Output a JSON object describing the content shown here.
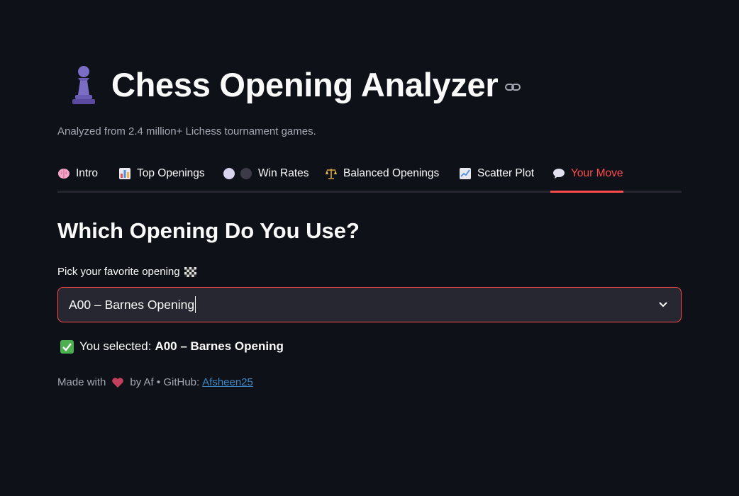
{
  "header": {
    "title": "Chess Opening Analyzer",
    "subtitle": "Analyzed from 2.4 million+ Lichess tournament games.",
    "icon": "pawn-icon",
    "anchor_icon": "link-icon"
  },
  "tabs": [
    {
      "label": "Intro",
      "icon": "brain-icon"
    },
    {
      "label": "Top Openings",
      "icon": "bar-chart-icon"
    },
    {
      "label": "Win Rates",
      "icon": "white-black-circles-icon"
    },
    {
      "label": "Balanced Openings",
      "icon": "scales-icon"
    },
    {
      "label": "Scatter Plot",
      "icon": "line-chart-icon"
    },
    {
      "label": "Your Move",
      "icon": "speech-bubble-icon",
      "active": true
    }
  ],
  "section": {
    "heading": "Which Opening Do You Use?",
    "select_label": "Pick your favorite opening",
    "select_label_icon": "checkered-flag-icon",
    "select_value": "A00 – Barnes Opening",
    "result_prefix": "You selected:",
    "result_value": "A00 – Barnes Opening",
    "result_icon": "check-mark-icon"
  },
  "footer": {
    "made_with": "Made with",
    "by": "by Af • GitHub:",
    "github_link": "Afsheen25",
    "heart_icon": "heart-icon"
  },
  "colors": {
    "background": "#0e1117",
    "accent": "#ff4b4b",
    "input_bg": "#262730",
    "muted_text": "#a3a8b4",
    "link": "#3f88c5"
  }
}
